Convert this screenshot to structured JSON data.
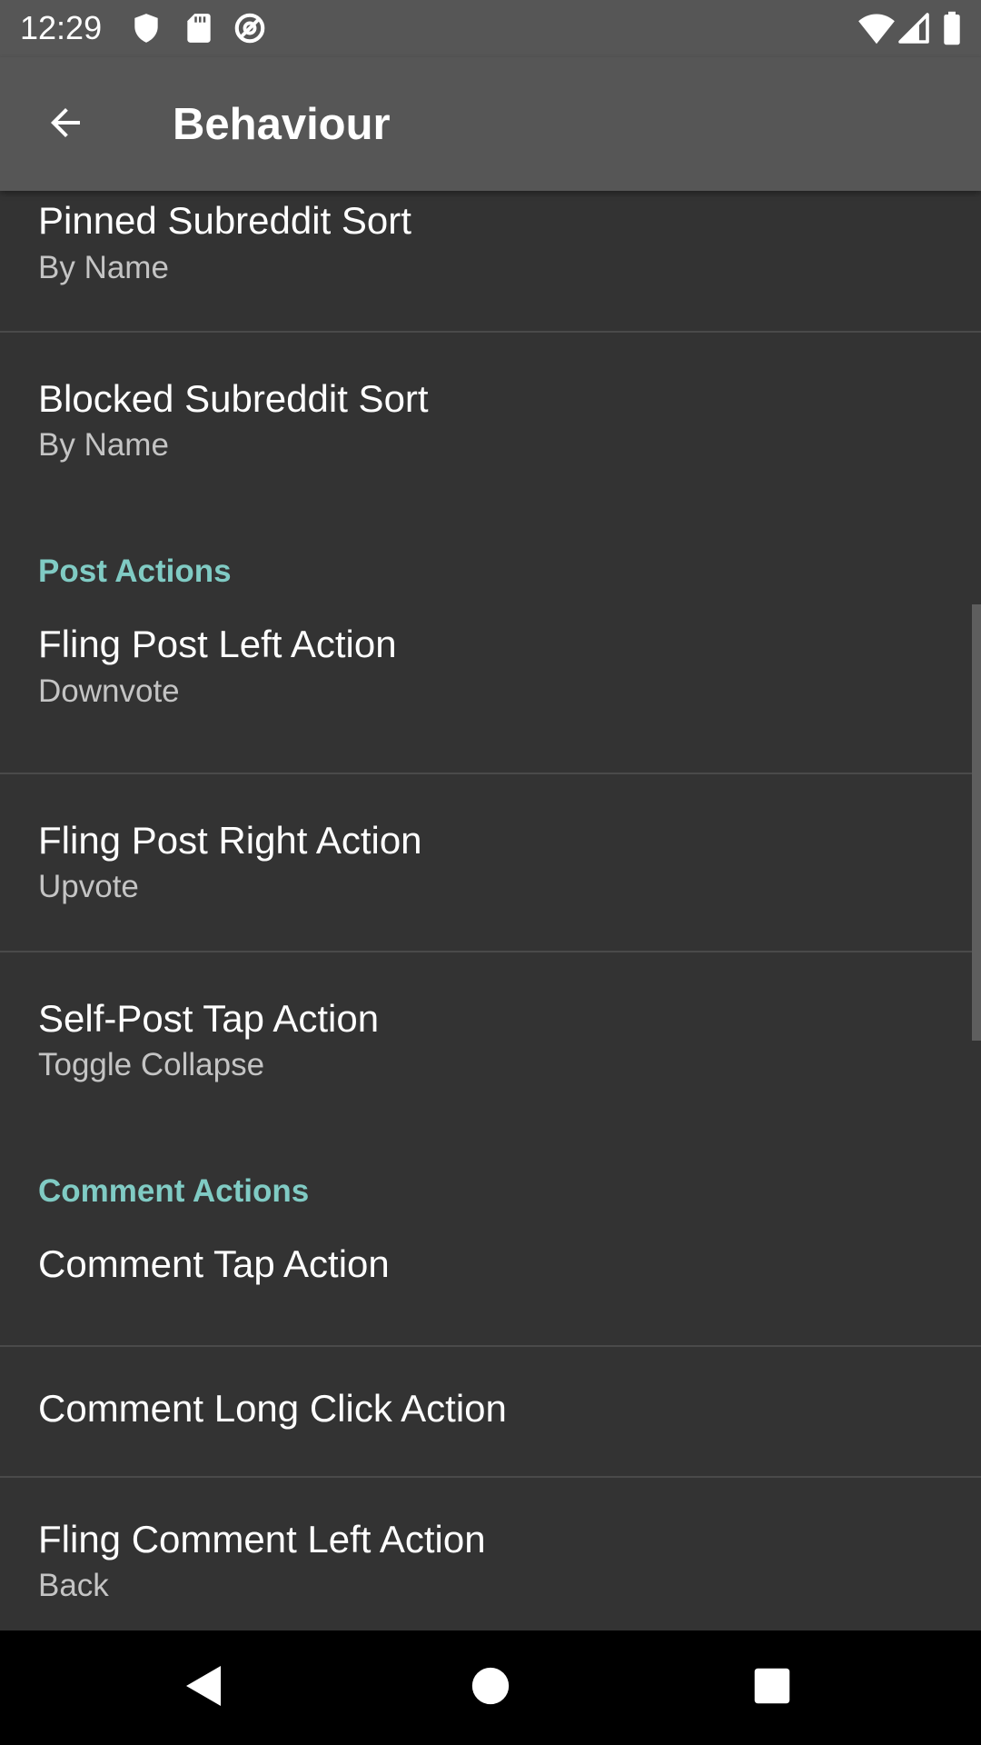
{
  "status_bar": {
    "time": "12:29",
    "left_icons": [
      "shield-icon",
      "sd-card-icon",
      "at-sign-icon"
    ],
    "right_icons": [
      "wifi-icon",
      "signal-icon",
      "battery-icon"
    ]
  },
  "app_bar": {
    "title": "Behaviour",
    "back_icon": "arrow-back-icon"
  },
  "colors": {
    "app_bar": "#565656",
    "background": "#333333",
    "category_accent": "#80cbc4",
    "summary_text": "#c4c4c4"
  },
  "preferences": {
    "pinned_subreddit_sort": {
      "title": "Pinned Subreddit Sort",
      "summary": "By Name"
    },
    "blocked_subreddit_sort": {
      "title": "Blocked Subreddit Sort",
      "summary": "By Name"
    },
    "post_actions_header": "Post Actions",
    "fling_post_left": {
      "title": "Fling Post Left Action",
      "summary": "Downvote"
    },
    "fling_post_right": {
      "title": "Fling Post Right Action",
      "summary": "Upvote"
    },
    "self_post_tap": {
      "title": "Self-Post Tap Action",
      "summary": "Toggle Collapse"
    },
    "comment_actions_header": "Comment Actions",
    "comment_tap": {
      "title": "Comment Tap Action"
    },
    "comment_long_click": {
      "title": "Comment Long Click Action"
    },
    "fling_comment_left": {
      "title": "Fling Comment Left Action",
      "summary": "Back"
    }
  },
  "nav_bar": {
    "icons": [
      "back-triangle-icon",
      "home-circle-icon",
      "recents-square-icon"
    ]
  }
}
